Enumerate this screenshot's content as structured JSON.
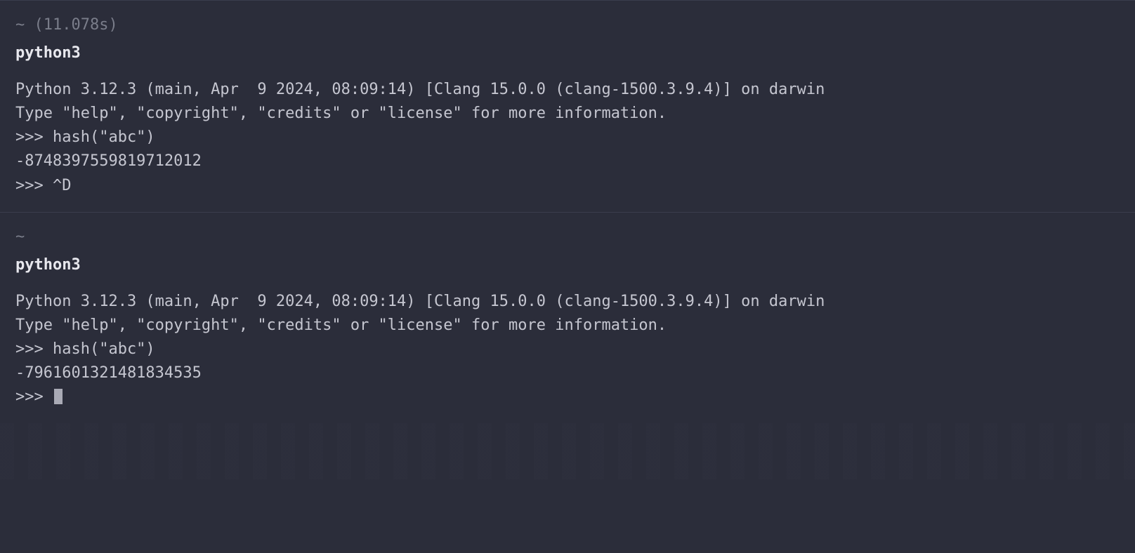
{
  "sessions": [
    {
      "cwd": "~",
      "timing": "(11.078s)",
      "command": "python3",
      "lines": [
        "Python 3.12.3 (main, Apr  9 2024, 08:09:14) [Clang 15.0.0 (clang-1500.3.9.4)] on darwin",
        "Type \"help\", \"copyright\", \"credits\" or \"license\" for more information.",
        ">>> hash(\"abc\")",
        "-8748397559819712012",
        ">>> ^D"
      ],
      "has_cursor": false
    },
    {
      "cwd": "~",
      "timing": "",
      "command": "python3",
      "lines": [
        "Python 3.12.3 (main, Apr  9 2024, 08:09:14) [Clang 15.0.0 (clang-1500.3.9.4)] on darwin",
        "Type \"help\", \"copyright\", \"credits\" or \"license\" for more information.",
        ">>> hash(\"abc\")",
        "-7961601321481834535",
        ">>> "
      ],
      "has_cursor": true
    }
  ]
}
